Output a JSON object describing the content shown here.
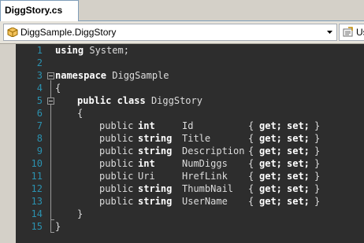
{
  "tab": {
    "title": "DiggStory.cs"
  },
  "navigation": {
    "type_selector": "DiggSample.DiggStory",
    "member_selector": "Us"
  },
  "colors": {
    "editor_bg": "#2d2d2d",
    "line_number": "#2b91af",
    "keyword": "#ffffff",
    "identifier": "#dcdcdc"
  },
  "code": {
    "line_numbers": [
      "1",
      "2",
      "3",
      "4",
      "5",
      "6",
      "7",
      "8",
      "9",
      "10",
      "11",
      "12",
      "13",
      "14",
      "15"
    ],
    "l1": {
      "kw": "using",
      "rest": " System;"
    },
    "l3": {
      "kw": "namespace",
      "rest": " DiggSample"
    },
    "l4": {
      "text": "{"
    },
    "l5": {
      "kw1": "public",
      "kw2": "class",
      "rest": " DiggStory"
    },
    "l6": {
      "text": "{"
    },
    "properties": [
      {
        "mod": "public",
        "type": "int",
        "name": "Id",
        "open": "{",
        "get": "get;",
        "set": "set;",
        "close": "}"
      },
      {
        "mod": "public",
        "type": "string",
        "name": "Title",
        "open": "{",
        "get": "get;",
        "set": "set;",
        "close": "}"
      },
      {
        "mod": "public",
        "type": "string",
        "name": "Description",
        "open": "{",
        "get": "get;",
        "set": "set;",
        "close": "}"
      },
      {
        "mod": "public",
        "type": "int",
        "name": "NumDiggs",
        "open": "{",
        "get": "get;",
        "set": "set;",
        "close": "}"
      },
      {
        "mod": "public",
        "type": "Uri",
        "name": "HrefLink",
        "open": "{",
        "get": "get;",
        "set": "set;",
        "close": "}"
      },
      {
        "mod": "public",
        "type": "string",
        "name": "ThumbNail",
        "open": "{",
        "get": "get;",
        "set": "set;",
        "close": "}"
      },
      {
        "mod": "public",
        "type": "string",
        "name": "UserName",
        "open": "{",
        "get": "get;",
        "set": "set;",
        "close": "}"
      }
    ],
    "l14": {
      "text": "}"
    },
    "l15": {
      "text": "}"
    }
  }
}
